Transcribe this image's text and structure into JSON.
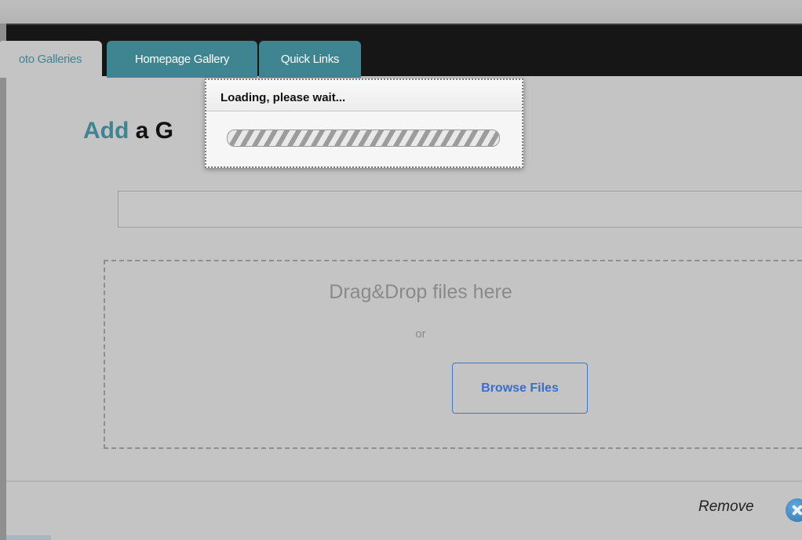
{
  "nav": {
    "tabs": [
      {
        "label": "oto Galleries",
        "active": true
      },
      {
        "label": "Homepage Gallery",
        "active": false
      },
      {
        "label": "Quick Links",
        "active": false
      }
    ]
  },
  "main": {
    "heading_accent": "Add",
    "heading_rest": " a G",
    "name_field": {
      "value": "",
      "placeholder": ""
    },
    "dropzone": {
      "title": "Drag&Drop files here",
      "or_text": "or",
      "browse_label": "Browse Files"
    },
    "remove_label": "Remove"
  },
  "loading_dialog": {
    "title": "Loading, please wait...",
    "progress_percent": 100
  },
  "colors": {
    "accent": "#3f8591",
    "link_blue": "#3a6fc4",
    "nav_bg": "#161616",
    "page_bg": "#c4c4c4"
  },
  "icons": {
    "remove": "close-circle-icon"
  }
}
